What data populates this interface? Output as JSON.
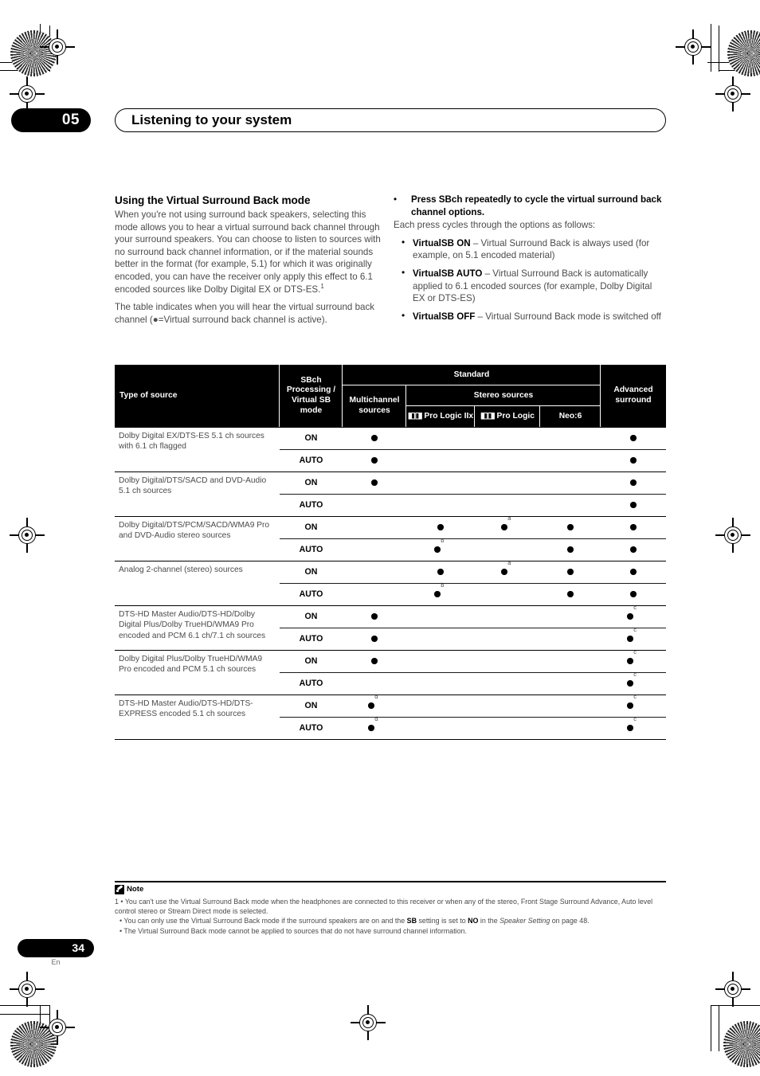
{
  "header": {
    "chapter_number": "05",
    "chapter_title": "Listening to your system"
  },
  "left_column": {
    "heading": "Using the Virtual Surround Back mode",
    "paragraph_1": "When you're not using surround back speakers, selecting this mode allows you to hear a virtual surround back channel through your surround speakers. You can choose to listen to sources with no surround back channel information, or if the material sounds better in the format (for example, 5.1) for which it was originally encoded, you can have the receiver only apply this effect to 6.1 encoded sources like Dolby Digital EX or DTS-ES.",
    "paragraph_1_footnote": "1",
    "paragraph_2": "The table indicates when you will hear the virtual surround back channel (●=Virtual surround back channel is active)."
  },
  "right_column": {
    "bullet_marker": "•",
    "instruction": "Press SBch repeatedly to cycle the virtual surround back channel options.",
    "each_press": "Each press cycles through the options as follows:",
    "options": [
      {
        "term": "VirtualSB ON",
        "dash": " – ",
        "desc": "Virtual Surround Back is always used (for example, on 5.1 encoded material)"
      },
      {
        "term": "VirtualSB AUTO",
        "dash": " – ",
        "desc": "Virtual Surround Back is automatically applied to 6.1 encoded sources (for example, Dolby Digital EX or DTS-ES)"
      },
      {
        "term": "VirtualSB OFF",
        "dash": " – ",
        "desc": "Virtual Surround Back mode is switched off"
      }
    ]
  },
  "table": {
    "headers": {
      "type_of_source": "Type of source",
      "sbch_mode": "SBch Processing / Virtual SB mode",
      "standard": "Standard",
      "multichannel": "Multichannel sources",
      "stereo_sources": "Stereo sources",
      "pro_logic_iix": "Pro Logic IIx",
      "pro_logic": "Pro Logic",
      "neo6": "Neo:6",
      "advanced_surround": "Advanced surround",
      "dolby_logo": "◧◨"
    },
    "mark_symbol": "●",
    "groups": [
      {
        "source": "Dolby Digital EX/DTS-ES 5.1 ch sources with 6.1 ch flagged",
        "rows": [
          {
            "mode": "ON",
            "multichannel": {
              "mark": true
            },
            "pro_logic_iix": {
              "mark": false
            },
            "pro_logic": {
              "mark": false
            },
            "neo6": {
              "mark": false
            },
            "advanced": {
              "mark": true
            }
          },
          {
            "mode": "AUTO",
            "multichannel": {
              "mark": true
            },
            "pro_logic_iix": {
              "mark": false
            },
            "pro_logic": {
              "mark": false
            },
            "neo6": {
              "mark": false
            },
            "advanced": {
              "mark": true
            }
          }
        ]
      },
      {
        "source": "Dolby Digital/DTS/SACD and DVD-Audio 5.1 ch sources",
        "rows": [
          {
            "mode": "ON",
            "multichannel": {
              "mark": true
            },
            "pro_logic_iix": {
              "mark": false
            },
            "pro_logic": {
              "mark": false
            },
            "neo6": {
              "mark": false
            },
            "advanced": {
              "mark": true
            }
          },
          {
            "mode": "AUTO",
            "multichannel": {
              "mark": false
            },
            "pro_logic_iix": {
              "mark": false
            },
            "pro_logic": {
              "mark": false
            },
            "neo6": {
              "mark": false
            },
            "advanced": {
              "mark": true
            }
          }
        ]
      },
      {
        "source": "Dolby Digital/DTS/PCM/SACD/WMA9 Pro and DVD-Audio stereo sources",
        "rows": [
          {
            "mode": "ON",
            "multichannel": {
              "mark": false
            },
            "pro_logic_iix": {
              "mark": true
            },
            "pro_logic": {
              "mark": true,
              "sup": "a"
            },
            "neo6": {
              "mark": true
            },
            "advanced": {
              "mark": true
            }
          },
          {
            "mode": "AUTO",
            "multichannel": {
              "mark": false
            },
            "pro_logic_iix": {
              "mark": true,
              "sup": "b"
            },
            "pro_logic": {
              "mark": false
            },
            "neo6": {
              "mark": true
            },
            "advanced": {
              "mark": true
            }
          }
        ]
      },
      {
        "source": "Analog 2-channel (stereo) sources",
        "rows": [
          {
            "mode": "ON",
            "multichannel": {
              "mark": false
            },
            "pro_logic_iix": {
              "mark": true
            },
            "pro_logic": {
              "mark": true,
              "sup": "a"
            },
            "neo6": {
              "mark": true
            },
            "advanced": {
              "mark": true
            }
          },
          {
            "mode": "AUTO",
            "multichannel": {
              "mark": false
            },
            "pro_logic_iix": {
              "mark": true,
              "sup": "b"
            },
            "pro_logic": {
              "mark": false
            },
            "neo6": {
              "mark": true
            },
            "advanced": {
              "mark": true
            }
          }
        ]
      },
      {
        "source": "DTS-HD Master Audio/DTS-HD/Dolby Digital Plus/Dolby TrueHD/WMA9 Pro encoded and PCM 6.1 ch/7.1 ch sources",
        "rows": [
          {
            "mode": "ON",
            "multichannel": {
              "mark": true
            },
            "pro_logic_iix": {
              "mark": false
            },
            "pro_logic": {
              "mark": false
            },
            "neo6": {
              "mark": false
            },
            "advanced": {
              "mark": true,
              "sup": "c"
            }
          },
          {
            "mode": "AUTO",
            "multichannel": {
              "mark": true
            },
            "pro_logic_iix": {
              "mark": false
            },
            "pro_logic": {
              "mark": false
            },
            "neo6": {
              "mark": false
            },
            "advanced": {
              "mark": true,
              "sup": "c"
            }
          }
        ]
      },
      {
        "source": "Dolby Digital Plus/Dolby TrueHD/WMA9 Pro encoded and PCM 5.1 ch sources",
        "rows": [
          {
            "mode": "ON",
            "multichannel": {
              "mark": true
            },
            "pro_logic_iix": {
              "mark": false
            },
            "pro_logic": {
              "mark": false
            },
            "neo6": {
              "mark": false
            },
            "advanced": {
              "mark": true,
              "sup": "c"
            }
          },
          {
            "mode": "AUTO",
            "multichannel": {
              "mark": false
            },
            "pro_logic_iix": {
              "mark": false
            },
            "pro_logic": {
              "mark": false
            },
            "neo6": {
              "mark": false
            },
            "advanced": {
              "mark": true,
              "sup": "c"
            }
          }
        ]
      },
      {
        "source": "DTS-HD Master Audio/DTS-HD/DTS-EXPRESS encoded 5.1 ch sources",
        "rows": [
          {
            "mode": "ON",
            "multichannel": {
              "mark": true,
              "sup": "d"
            },
            "pro_logic_iix": {
              "mark": false
            },
            "pro_logic": {
              "mark": false
            },
            "neo6": {
              "mark": false
            },
            "advanced": {
              "mark": true,
              "sup": "c"
            }
          },
          {
            "mode": "AUTO",
            "multichannel": {
              "mark": true,
              "sup": "d"
            },
            "pro_logic_iix": {
              "mark": false
            },
            "pro_logic": {
              "mark": false
            },
            "neo6": {
              "mark": false
            },
            "advanced": {
              "mark": true,
              "sup": "c"
            }
          }
        ]
      }
    ]
  },
  "note": {
    "title": "Note",
    "item_1_number": "1",
    "item_1": "You can't use the Virtual Surround Back mode when the headphones are connected to this receiver or when any of the stereo, Front Stage Surround Advance, Auto level control stereo or Stream Direct mode is selected.",
    "item_2_a": "You can only use the Virtual Surround Back mode if the surround speakers are on and the ",
    "item_2_b": "SB",
    "item_2_c": " setting is set to ",
    "item_2_d": "NO",
    "item_2_e": " in the ",
    "item_2_f": "Speaker Setting",
    "item_2_g": " on page 48.",
    "item_3": "The Virtual Surround Back mode cannot be applied to sources that do not have surround channel information."
  },
  "footer": {
    "page_number": "34",
    "language": "En"
  }
}
